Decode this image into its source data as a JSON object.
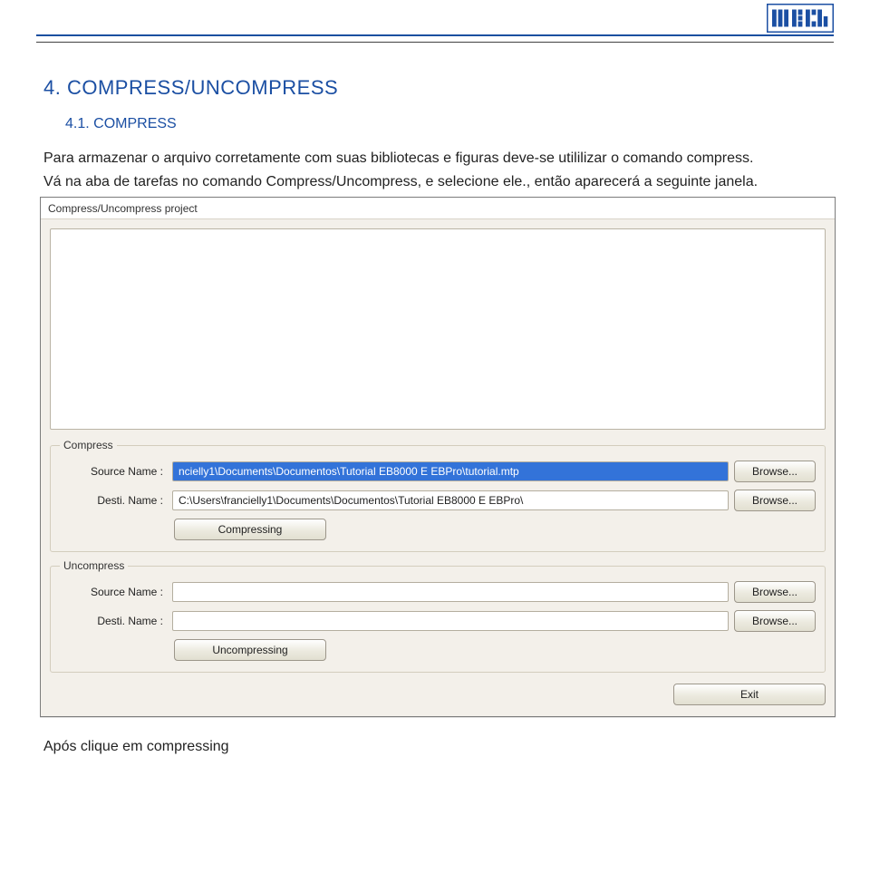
{
  "logo_text": "WEG",
  "heading_main": "4.  COMPRESS/UNCOMPRESS",
  "heading_sub": "4.1. COMPRESS",
  "body_para1": "Para armazenar o arquivo corretamente com suas bibliotecas e figuras deve-se utililizar o comando compress.",
  "body_para2": "Vá na aba de tarefas no comando Compress/Uncompress, e selecione ele., então aparecerá a seguinte janela.",
  "dialog": {
    "title": "Compress/Uncompress project",
    "compress": {
      "legend": "Compress",
      "source_label": "Source Name :",
      "source_value": "ncielly1\\Documents\\Documentos\\Tutorial EB8000 E EBPro\\tutorial.mtp",
      "dest_label": "Desti. Name :",
      "dest_value": "C:\\Users\\francielly1\\Documents\\Documentos\\Tutorial EB8000 E EBPro\\",
      "browse_label": "Browse...",
      "action_label": "Compressing"
    },
    "uncompress": {
      "legend": "Uncompress",
      "source_label": "Source Name :",
      "source_value": "",
      "dest_label": "Desti. Name :",
      "dest_value": "",
      "browse_label": "Browse...",
      "action_label": "Uncompressing"
    },
    "exit_label": "Exit"
  },
  "post_text": "Após clique em compressing"
}
